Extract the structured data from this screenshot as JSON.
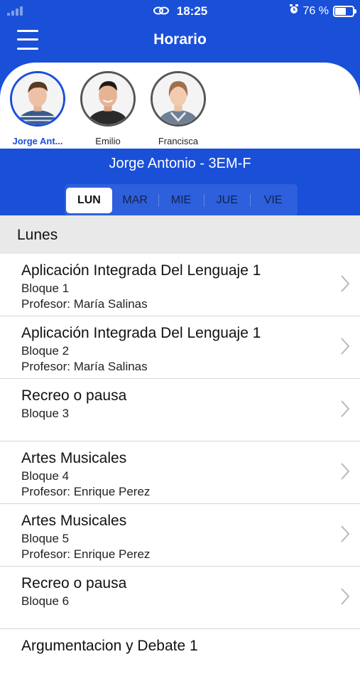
{
  "status_bar": {
    "time": "18:25",
    "battery": "76 %",
    "battery_level": 0.76
  },
  "header": {
    "title": "Horario"
  },
  "students": [
    {
      "name": "Jorge Ant...",
      "active": true
    },
    {
      "name": "Emilio",
      "active": false
    },
    {
      "name": "Francisca",
      "active": false
    }
  ],
  "course": {
    "label": "Jorge Antonio - 3EM-F"
  },
  "days": [
    {
      "label": "LUN",
      "selected": true
    },
    {
      "label": "MAR",
      "selected": false
    },
    {
      "label": "MIE",
      "selected": false
    },
    {
      "label": "JUE",
      "selected": false
    },
    {
      "label": "VIE",
      "selected": false
    }
  ],
  "section": {
    "title": "Lunes"
  },
  "schedule": [
    {
      "title": "Aplicación Integrada Del Lenguaje 1",
      "block": "Bloque 1",
      "teacher": "Profesor: María Salinas"
    },
    {
      "title": "Aplicación Integrada Del Lenguaje 1",
      "block": "Bloque 2",
      "teacher": "Profesor: María Salinas"
    },
    {
      "title": "Recreo o pausa",
      "block": "Bloque 3",
      "teacher": ""
    },
    {
      "title": "Artes Musicales",
      "block": "Bloque 4",
      "teacher": "Profesor: Enrique Perez"
    },
    {
      "title": "Artes Musicales",
      "block": "Bloque 5",
      "teacher": "Profesor: Enrique Perez"
    },
    {
      "title": "Recreo o pausa",
      "block": "Bloque 6",
      "teacher": ""
    },
    {
      "title": "Argumentacion y Debate 1",
      "block": "",
      "teacher": ""
    }
  ],
  "colors": {
    "primary": "#1a4fd8",
    "section_bg": "#e9e9e9"
  }
}
